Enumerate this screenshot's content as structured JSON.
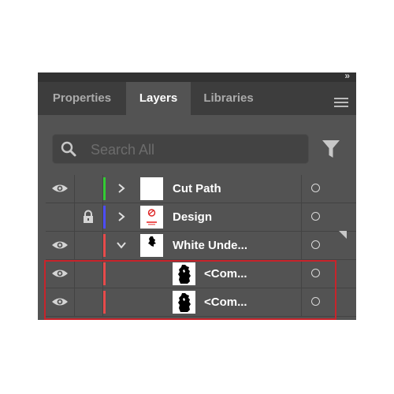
{
  "panel": {
    "collapse_glyph": "»",
    "tabs": [
      {
        "label": "Properties",
        "active": false
      },
      {
        "label": "Layers",
        "active": true
      },
      {
        "label": "Libraries",
        "active": false
      }
    ],
    "menu_icon": "hamburger-menu-icon"
  },
  "search": {
    "placeholder": "Search All",
    "value": ""
  },
  "icons": {
    "search": "search-icon",
    "filter": "filter-icon",
    "visibility": "eye-icon",
    "lock": "lock-icon",
    "expand": "chevron-right-icon",
    "collapse": "chevron-down-icon",
    "target": "target-circle-icon"
  },
  "layers": [
    {
      "name": "Cut Path",
      "color": "#33cc33",
      "visible": true,
      "locked": false,
      "expanded": false,
      "indent": 0,
      "thumb": "blank"
    },
    {
      "name": "Design",
      "color": "#4d4dff",
      "visible": false,
      "locked": true,
      "expanded": false,
      "indent": 0,
      "thumb": "design"
    },
    {
      "name": "White Unde...",
      "color": "#e84b4b",
      "visible": true,
      "locked": false,
      "expanded": true,
      "indent": 0,
      "thumb": "silhouette-small"
    },
    {
      "name": "<Com...",
      "color": "#e84b4b",
      "visible": true,
      "locked": false,
      "expanded": null,
      "indent": 1,
      "thumb": "silhouette"
    },
    {
      "name": "<Com...",
      "color": "#e84b4b",
      "visible": true,
      "locked": false,
      "expanded": null,
      "indent": 1,
      "thumb": "silhouette"
    }
  ],
  "colors": {
    "panel_bg": "#535353",
    "tabbar_bg": "#3d3d3d",
    "highlight_border": "#c8242b"
  }
}
